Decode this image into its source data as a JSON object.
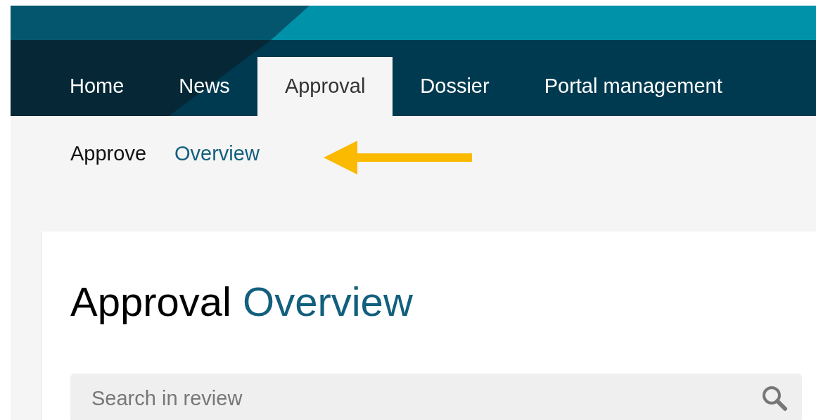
{
  "main_nav": [
    {
      "label": "Home",
      "selected": false
    },
    {
      "label": "News",
      "selected": false
    },
    {
      "label": "Approval",
      "selected": true
    },
    {
      "label": "Dossier",
      "selected": false
    },
    {
      "label": "Portal management",
      "selected": false
    }
  ],
  "sub_nav": [
    {
      "label": "Approve",
      "selected": false
    },
    {
      "label": "Overview",
      "selected": true
    }
  ],
  "page_title": {
    "main": "Approval",
    "accent": "Overview"
  },
  "search": {
    "placeholder": "Search in review"
  }
}
